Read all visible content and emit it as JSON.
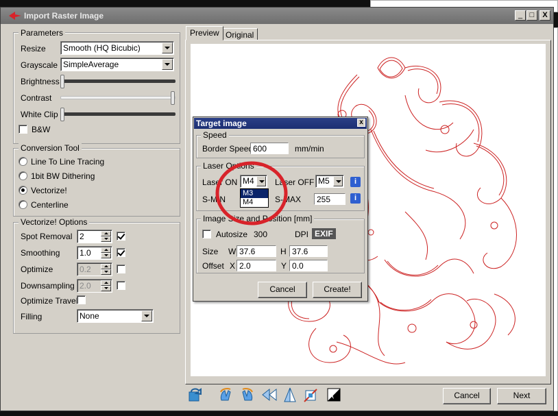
{
  "window": {
    "title": "Import Raster Image",
    "min": "_",
    "max": "□",
    "close": "X"
  },
  "parameters": {
    "title": "Parameters",
    "resize_label": "Resize",
    "resize_value": "Smooth (HQ Bicubic)",
    "grayscale_label": "Grayscale",
    "grayscale_value": "SimpleAverage",
    "brightness_label": "Brightness",
    "contrast_label": "Contrast",
    "whiteclip_label": "White Clip",
    "bw_label": "B&W"
  },
  "conversion": {
    "title": "Conversion Tool",
    "options": [
      "Line To Line Tracing",
      "1bit BW Dithering",
      "Vectorize!",
      "Centerline"
    ],
    "selected": "Vectorize!"
  },
  "vectorize": {
    "title": "Vectorize! Options",
    "spot_removal_label": "Spot Removal",
    "spot_removal_value": "2",
    "smoothing_label": "Smoothing",
    "smoothing_value": "1.0",
    "optimize_label": "Optimize",
    "optimize_value": "0.2",
    "downsampling_label": "Downsampling",
    "downsampling_value": "2.0",
    "optimize_travel_label": "Optimize Travel",
    "filling_label": "Filling",
    "filling_value": "None"
  },
  "tabs": [
    "Preview",
    "Original"
  ],
  "footer": {
    "cancel": "Cancel",
    "next": "Next"
  },
  "dialog": {
    "title": "Target image",
    "close": "x",
    "speed_group": "Speed",
    "border_speed_label": "Border Speed",
    "border_speed_value": "600",
    "border_speed_unit": "mm/min",
    "laser_group": "Laser Options",
    "laser_on_label": "Laser ON",
    "laser_on_value": "M4",
    "laser_off_label": "Laser OFF",
    "laser_off_value": "M5",
    "laser_on_options": [
      "M3",
      "M4"
    ],
    "smin_label": "S-MIN",
    "smax_label": "S-MAX",
    "smax_value": "255",
    "info_glyph": "i",
    "size_group": "Image Size and Position [mm]",
    "autosize_label": "Autosize",
    "dpi_value": "300",
    "dpi_label": "DPI",
    "exif": "EXIF",
    "size_label": "Size",
    "w_label": "W",
    "w_value": "37.6",
    "h_label": "H",
    "h_value": "37.6",
    "offset_label": "Offset",
    "x_label": "X",
    "x_value": "2.0",
    "y_label": "Y",
    "y_value": "0.0",
    "cancel": "Cancel",
    "create": "Create!"
  },
  "colors": {
    "accent_red": "#d8232a",
    "preview_line": "#cc2222",
    "dialog_title": "#1c2f73"
  }
}
